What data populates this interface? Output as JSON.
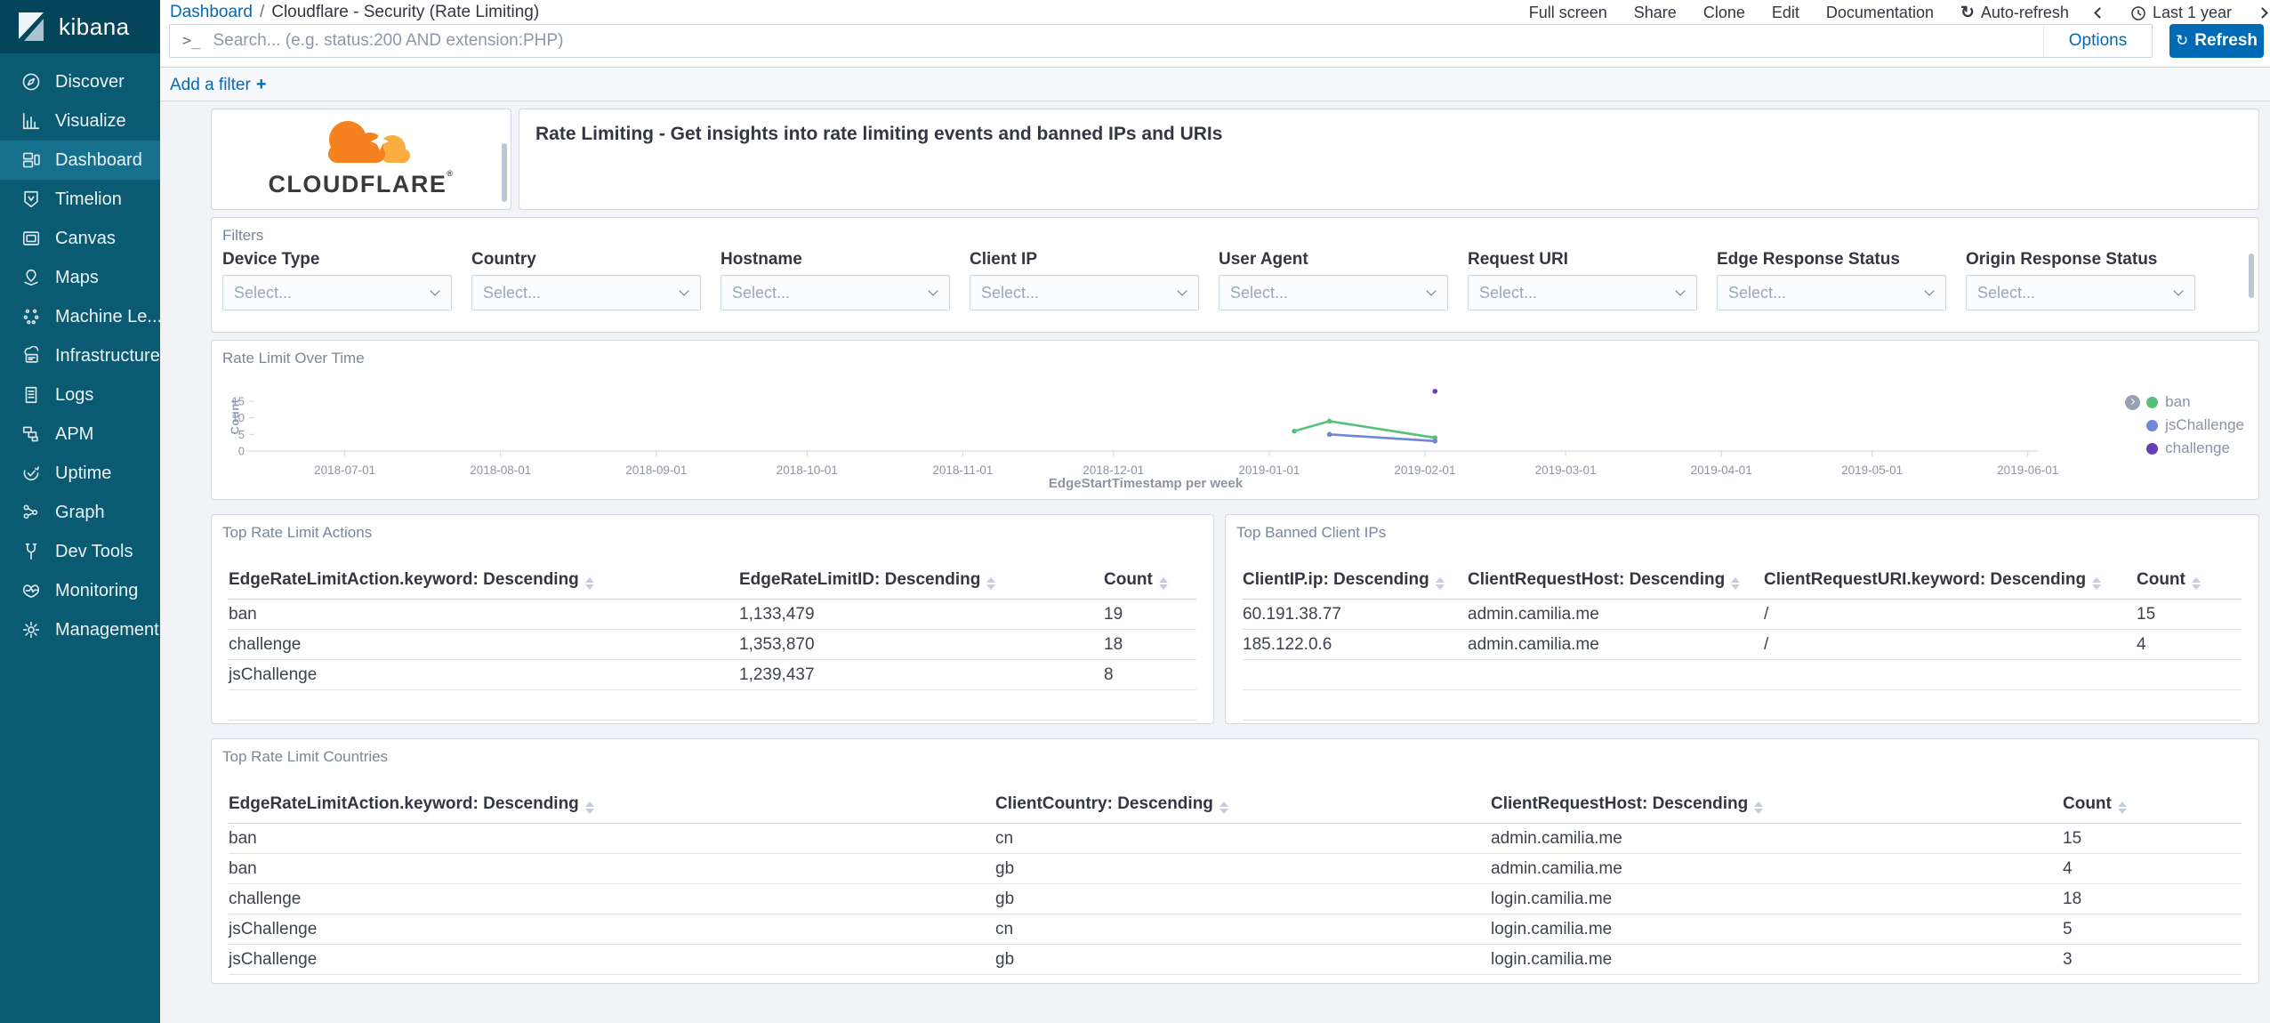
{
  "sidebar": {
    "logo_text": "kibana",
    "items": [
      {
        "label": "Discover",
        "icon": "compass-icon",
        "active": false
      },
      {
        "label": "Visualize",
        "icon": "bar-chart-icon",
        "active": false
      },
      {
        "label": "Dashboard",
        "icon": "dashboard-icon",
        "active": true
      },
      {
        "label": "Timelion",
        "icon": "timelion-icon",
        "active": false
      },
      {
        "label": "Canvas",
        "icon": "canvas-icon",
        "active": false
      },
      {
        "label": "Maps",
        "icon": "map-pin-icon",
        "active": false
      },
      {
        "label": "Machine Le...",
        "icon": "machine-learning-icon",
        "active": false
      },
      {
        "label": "Infrastructure",
        "icon": "infrastructure-icon",
        "active": false
      },
      {
        "label": "Logs",
        "icon": "logs-icon",
        "active": false
      },
      {
        "label": "APM",
        "icon": "apm-icon",
        "active": false
      },
      {
        "label": "Uptime",
        "icon": "uptime-icon",
        "active": false
      },
      {
        "label": "Graph",
        "icon": "graph-icon",
        "active": false
      },
      {
        "label": "Dev Tools",
        "icon": "wrench-icon",
        "active": false
      },
      {
        "label": "Monitoring",
        "icon": "monitoring-icon",
        "active": false
      },
      {
        "label": "Management",
        "icon": "gear-icon",
        "active": false
      }
    ]
  },
  "topbar": {
    "breadcrumb": {
      "root": "Dashboard",
      "separator": "/",
      "current": "Cloudflare - Security (Rate Limiting)"
    },
    "menu": [
      "Full screen",
      "Share",
      "Clone",
      "Edit",
      "Documentation"
    ],
    "auto_refresh_label": "Auto-refresh",
    "time_picker": {
      "label": "Last 1 year"
    }
  },
  "search": {
    "placeholder": "Search... (e.g. status:200 AND extension:PHP)",
    "options_label": "Options",
    "refresh_label": "Refresh"
  },
  "filter_bar": {
    "add_filter_label": "Add a filter",
    "plus": "+"
  },
  "panels": {
    "logo": {
      "brand": "CLOUDFLARE",
      "registered": "®"
    },
    "markdown": {
      "text": "Rate Limiting - Get insights into rate limiting events and banned IPs and URIs"
    },
    "filters": {
      "title": "Filters",
      "select_placeholder": "Select...",
      "fields": [
        "Device Type",
        "Country",
        "Hostname",
        "Client IP",
        "User Agent",
        "Request URI",
        "Edge Response Status",
        "Origin Response Status"
      ]
    },
    "actions_table": {
      "title": "Top Rate Limit Actions",
      "columns": [
        "EdgeRateLimitAction.keyword: Descending",
        "EdgeRateLimitID: Descending",
        "Count"
      ],
      "rows": [
        [
          "ban",
          "1,133,479",
          "19"
        ],
        [
          "challenge",
          "1,353,870",
          "18"
        ],
        [
          "jsChallenge",
          "1,239,437",
          "8"
        ]
      ]
    },
    "banned_ips_table": {
      "title": "Top Banned Client IPs",
      "columns": [
        "ClientIP.ip: Descending",
        "ClientRequestHost: Descending",
        "ClientRequestURI.keyword: Descending",
        "Count"
      ],
      "rows": [
        [
          "60.191.38.77",
          "admin.camilia.me",
          "/",
          "15"
        ],
        [
          "185.122.0.6",
          "admin.camilia.me",
          "/",
          "4"
        ]
      ]
    },
    "countries_table": {
      "title": "Top Rate Limit Countries",
      "columns": [
        "EdgeRateLimitAction.keyword: Descending",
        "ClientCountry: Descending",
        "ClientRequestHost: Descending",
        "Count"
      ],
      "rows": [
        [
          "ban",
          "cn",
          "admin.camilia.me",
          "15"
        ],
        [
          "ban",
          "gb",
          "admin.camilia.me",
          "4"
        ],
        [
          "challenge",
          "gb",
          "login.camilia.me",
          "18"
        ],
        [
          "jsChallenge",
          "cn",
          "login.camilia.me",
          "5"
        ],
        [
          "jsChallenge",
          "gb",
          "login.camilia.me",
          "3"
        ]
      ]
    }
  },
  "chart_data": {
    "type": "line",
    "title": "Rate Limit Over Time",
    "xlabel": "EdgeStartTimestamp per week",
    "ylabel": "Count",
    "x_domain": [
      "2018-06-13",
      "2019-06-03"
    ],
    "x_ticks": [
      "2018-07-01",
      "2018-08-01",
      "2018-09-01",
      "2018-10-01",
      "2018-11-01",
      "2018-12-01",
      "2019-01-01",
      "2019-02-01",
      "2019-03-01",
      "2019-04-01",
      "2019-05-01",
      "2019-06-01"
    ],
    "y_ticks": [
      0,
      5,
      10,
      15
    ],
    "ylim": [
      0,
      18.5
    ],
    "grid": false,
    "legend_position": "right",
    "series": [
      {
        "name": "ban",
        "color": "#57c17b",
        "points": [
          [
            "2019-01-06",
            6
          ],
          [
            "2019-01-13",
            9
          ],
          [
            "2019-02-03",
            4
          ]
        ]
      },
      {
        "name": "jsChallenge",
        "color": "#6f87d8",
        "points": [
          [
            "2019-01-13",
            5
          ],
          [
            "2019-02-03",
            3
          ]
        ]
      },
      {
        "name": "challenge",
        "color": "#663db8",
        "points": [
          [
            "2019-02-03",
            18
          ]
        ]
      }
    ]
  },
  "colors": {
    "primary": "#006BB4",
    "sidebar_teal": "#0a5a72",
    "sidebar_selected": "#17718e",
    "cloudflare_orange": "#F6821F",
    "cloudflare_light_orange": "#FBAD41",
    "series_ban": "#57c17b",
    "series_jschallenge": "#6f87d8",
    "series_challenge": "#663db8"
  }
}
